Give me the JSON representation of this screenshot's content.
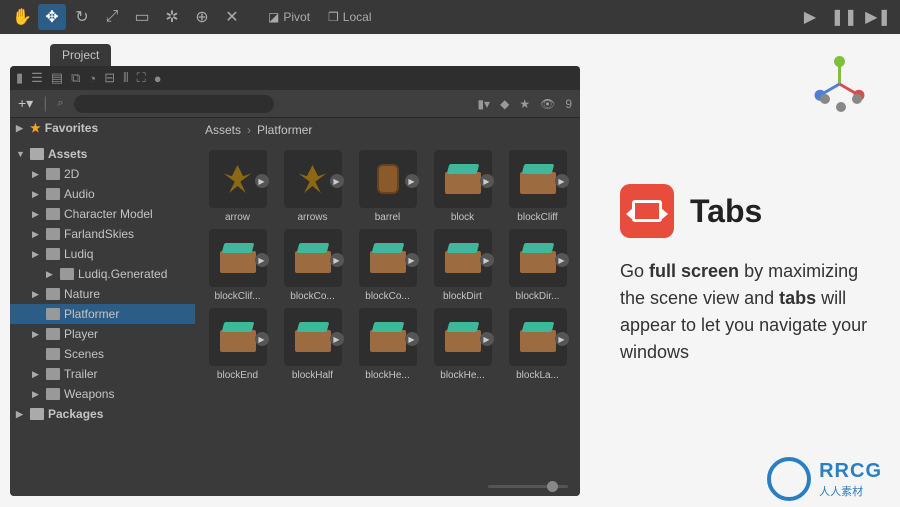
{
  "toolbar": {
    "pivot": "Pivot",
    "local": "Local"
  },
  "tab": "Project",
  "panel": {
    "search_placeholder": "",
    "hidden_count": "9"
  },
  "breadcrumb": [
    "Assets",
    "Platformer"
  ],
  "tree": {
    "favorites": "Favorites",
    "assets": "Assets",
    "items": [
      "2D",
      "Audio",
      "Character Model",
      "FarlandSkies",
      "Ludiq",
      "Ludiq.Generated",
      "Nature",
      "Platformer",
      "Player",
      "Scenes",
      "Trailer",
      "Weapons"
    ],
    "packages": "Packages"
  },
  "assets": [
    "arrow",
    "arrows",
    "barrel",
    "block",
    "blockCliff",
    "blockClif...",
    "blockCo...",
    "blockCo...",
    "blockDirt",
    "blockDir...",
    "blockEnd",
    "blockHalf",
    "blockHe...",
    "blockHe...",
    "blockLa..."
  ],
  "feature": {
    "title": "Tabs",
    "desc_1": "Go ",
    "desc_2": "full screen",
    "desc_3": " by maximizing the scene view and ",
    "desc_4": "tabs",
    "desc_5": " will appear to let you navigate your windows"
  },
  "watermark": {
    "text": "RRCG",
    "sub": "人人素材"
  }
}
